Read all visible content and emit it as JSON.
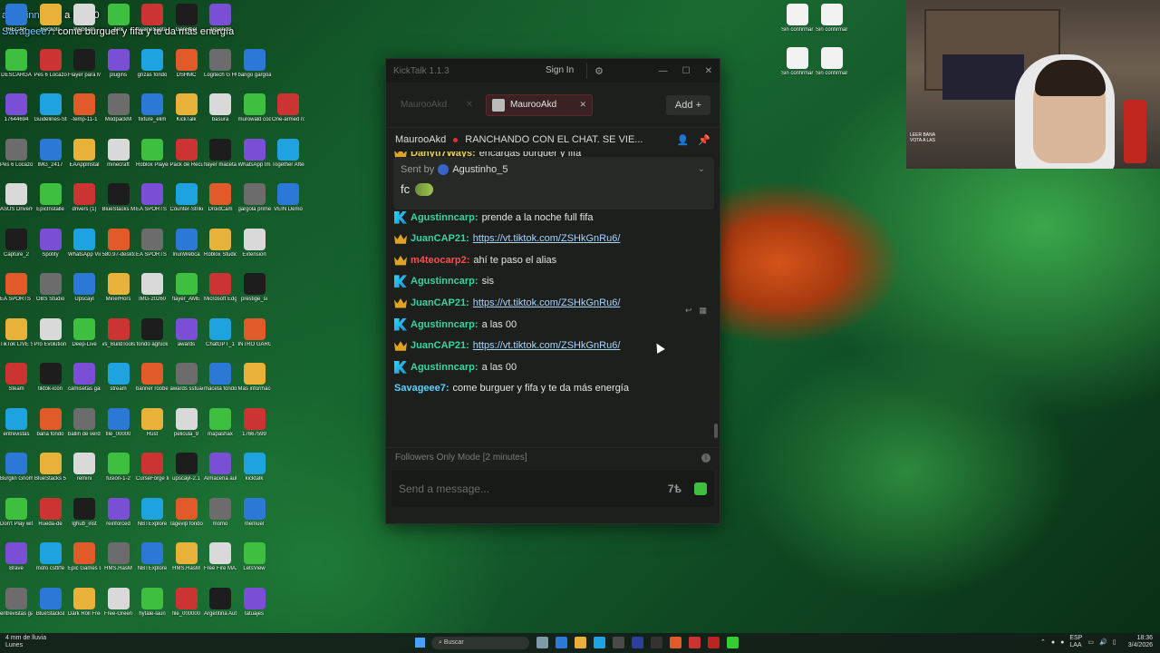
{
  "overlay_chat": [
    {
      "user": "agustinncarp",
      "text": ": a las 00"
    },
    {
      "user": "Savageee7",
      "text": ": come burguer y fifa y te da más energía"
    }
  ],
  "desktop_icons_left": [
    [
      "IRECAR",
      "Recaptc",
      "Webcam",
      "Amr",
      "GameSanta",
      "GenReel",
      "argamod"
    ],
    [
      "DESCARGA",
      "Pes 6 Locazos",
      "Flayer para Miguel",
      "plugins",
      "grizas fondo",
      "DSHMC",
      "Logitech G HUB",
      "bango gargoals"
    ],
    [
      "17644694",
      "Guidelines-Streams",
      "-temp-11-1",
      "ModpackM",
      "fixture_elim",
      "KickTalk",
      "basura",
      "murowald code",
      "One-armed robber"
    ],
    [
      "Pes 6 Locazos",
      "IMG_2417",
      "EAAppInstal",
      "minecraft",
      "Roblox Player",
      "Pack de Recursos",
      "flayer maceta",
      "WhatsApp Image 2026",
      "Together After Dark"
    ],
    [
      "ASUS DriverHub",
      "EpicInstalle",
      "drivers (1)",
      "BlueStacks Multi-Insta",
      "EA SPORTS FC 26",
      "Counter-Strike 2",
      "DroidCam",
      "gargola primer e",
      "VEIN Demo"
    ],
    [
      "Capture_2",
      "Spotify",
      "WhatsApp Video 2025",
      "580.97-deskto",
      "EA SPORTS FC 25",
      "IriunWebca",
      "Roblox Studio",
      "Extension"
    ],
    [
      "EA SPORTS FC 26",
      "OBS Studio",
      "Upscayl",
      "MinerHors",
      "IMG-20260",
      "flayer_AME",
      "Microsoft Edge",
      "prestige_si"
    ],
    [
      "TikTok LIVE Studio",
      "Pro Evolution Soccer 6",
      "Deep-Live",
      "vs_BuildTools",
      "fondo agruck",
      "awards",
      "ChatGPT_1",
      "INTRO GARGO"
    ],
    [
      "Steam",
      "tiktok-icon",
      "camisetas gargolas",
      "stream",
      "banner roobet",
      "awards sstuac",
      "maceta fondo",
      "Más informaci"
    ],
    [
      "entrevistas",
      "bana fondo",
      "ballin de verdad",
      "file_00000",
      "Rust",
      "pelicula_9",
      "mapashax",
      "17667599"
    ],
    [
      "Burglin Gnom",
      "BlueStacks 5",
      "remini",
      "fusion-1-2",
      "CurseForge Installer",
      "upscayl-2.1",
      "Almacena automatic",
      "kicktalk"
    ],
    [
      "Don't Play with Gnom",
      "Rueda-de",
      "lghub_inst",
      "reinforced",
      "NBTExplore",
      "ragevip fondo",
      "momo",
      "memuel"
    ],
    [
      "Brave",
      "mofo csttrfe",
      "Epic Games Launcher",
      "HMS.HasM",
      "NBTExplore",
      "HMS.HasM",
      "Free Fire MAX",
      "LetsView"
    ],
    [
      "entrevistas gargolas",
      "BlueStacksl",
      "Dark Roll Free Kic",
      "Free-Green",
      "hytale-laun",
      "file_000000",
      "Argentina Auth",
      "tatuajes"
    ]
  ],
  "desktop_icons_right": [
    "Sin confirmar 356677c",
    "Sin confirmar 1/7051028",
    "Sin confirmar 894133.crd",
    "Sin confirmar 1/7051028"
  ],
  "webcam_text": "LEER BANA VOTA A LAS",
  "window": {
    "app_title": "KickTalk 1.1.3",
    "sign_in": "Sign In",
    "tabs": [
      {
        "label": "MaurooAkd",
        "active": false
      },
      {
        "label": "MaurooAkd",
        "active": true
      }
    ],
    "add_label": "Add",
    "channel_name": "MaurooAkd",
    "stream_title": "RANCHANDO CON EL CHAT. SE VIE...",
    "pinned": {
      "sent_by_label": "Sent by",
      "sent_by_user": "Agustinho_5",
      "text": "fc"
    },
    "messages": [
      {
        "badge": "crown",
        "user": "Danyti7Ways",
        "color": "#e9d24e",
        "text": "encargas burguer y fifa",
        "link": false
      },
      {
        "badge": "kick",
        "user": "Agustinncarp",
        "color": "#35d5a2",
        "text": "prende a la noche full fifa",
        "link": false
      },
      {
        "badge": "kick",
        "user": "Agustinncarp",
        "color": "#35d5a2",
        "text": "prende a la noche full fifa",
        "link": false
      },
      {
        "badge": "kick",
        "user": "Agustinncarp",
        "color": "#35d5a2",
        "text": "prende a la noche full fifa",
        "link": false
      },
      {
        "badge": "crown",
        "user": "JuanCAP21",
        "color": "#35d5a2",
        "text": "https://vt.tiktok.com/ZSHkGnRu6/",
        "link": true
      },
      {
        "badge": "crown",
        "user": "m4teocarp2",
        "color": "#ff4d4d",
        "text": "ahí te paso el alias",
        "link": false
      },
      {
        "badge": "kick",
        "user": "Agustinncarp",
        "color": "#35d5a2",
        "text": "sis",
        "link": false
      },
      {
        "badge": "crown",
        "user": "JuanCAP21",
        "color": "#35d5a2",
        "text": "https://vt.tiktok.com/ZSHkGnRu6/",
        "link": true
      },
      {
        "badge": "kick",
        "user": "Agustinncarp",
        "color": "#35d5a2",
        "text": "a las 00",
        "link": false
      },
      {
        "badge": "crown",
        "user": "JuanCAP21",
        "color": "#35d5a2",
        "text": "https://vt.tiktok.com/ZSHkGnRu6/",
        "link": true
      },
      {
        "badge": "kick",
        "user": "Agustinncarp",
        "color": "#35d5a2",
        "text": "a las 00",
        "link": false
      },
      {
        "badge": "none",
        "user": "Savageee7",
        "color": "#5ad0ff",
        "text": "come burguer y fifa y te da más energía",
        "link": false
      }
    ],
    "mode_text": "Followers Only Mode [2 minutes]",
    "input_placeholder": "Send a message..."
  },
  "taskbar": {
    "weather": "4 mm de lluvia",
    "weather_sub": "Lunes",
    "search_placeholder": "Buscar",
    "lang": "ESP",
    "lang_sub": "LAA",
    "time": "18:36",
    "date": "3/4/2026"
  }
}
